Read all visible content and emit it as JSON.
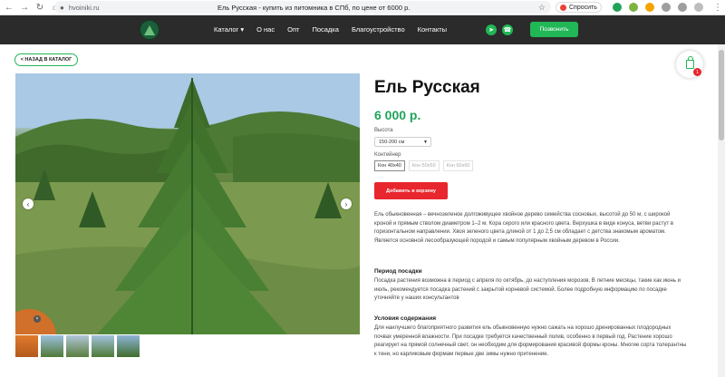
{
  "browser": {
    "url": "hvoiniki.ru",
    "tab_title": "Ель Русская - купить из питомника в СПб, по цене от 6000 р.",
    "translate_label": "Спросить",
    "back_icon": "arrow-left-icon",
    "forward_icon": "arrow-right-icon",
    "reload_icon": "reload-icon"
  },
  "header": {
    "menu": [
      "Каталог ▾",
      "О нас",
      "Опт",
      "Посадка",
      "Благоустройство",
      "Контакты"
    ],
    "call_button": "Позвонить",
    "accent": "#21b756"
  },
  "back_link": "< НАЗАД В КАТАЛОГ",
  "product": {
    "title": "Ель Русская",
    "price": "6 000 р.",
    "height_label": "Высота",
    "height_value": "150-200 см",
    "container_label": "Контейнер",
    "containers": [
      "Кон 40х40",
      "Кон 50х50",
      "Кон 60х60"
    ],
    "add_to_cart": "Добавить в корзину",
    "description": "Ель обыкновенная – вечнозеленое долгоживущее хвойное дерево семейства сосновых, высотой до 50 м, с широкой кроной и прямым стволом диаметром 1–2 м. Кора серого или красного цвета. Верхушка в виде конуса, ветви растут в горизонтальном направлении. Хвоя зеленого цвета длиной от 1 до 2,5 см обладает с детства знакомым ароматом. Является основной лесообразующей породой и самым популярным хвойным деревом в России.",
    "planting_title": "Период посадки",
    "planting_text": "Посадка растения возможна в период с апреля по октябрь, до наступления морозов. В летние месяцы, такие как июнь и июль, рекомендуется посадка растений с закрытой корневой системой. Более подробную информацию по посадке уточняйте у наших консультантов",
    "care_title": "Условия содержания",
    "care_text": "Для наилучшего благоприятного развития ель обыкновенную нужно сажать на хорошо дренированных плодородных почвах умеренной влажности. При посадке требуется качественный полив, особенно в первый год. Растение хорошо реагирует на прямой солнечный свет, он необходим для формирования красивой формы кроны. Многие сорта толерантны к тени, но карликовым формам первые две зимы нужно притенение."
  },
  "cart": {
    "count": "1"
  }
}
